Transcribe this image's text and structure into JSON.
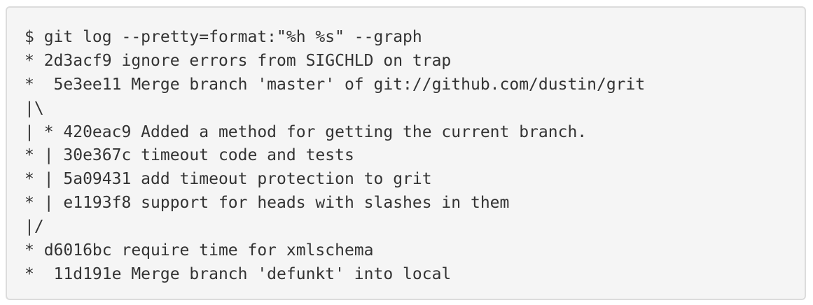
{
  "code_block": {
    "lines": [
      "$ git log --pretty=format:\"%h %s\" --graph",
      "* 2d3acf9 ignore errors from SIGCHLD on trap",
      "*  5e3ee11 Merge branch 'master' of git://github.com/dustin/grit",
      "|\\",
      "| * 420eac9 Added a method for getting the current branch.",
      "* | 30e367c timeout code and tests",
      "* | 5a09431 add timeout protection to grit",
      "* | e1193f8 support for heads with slashes in them",
      "|/",
      "* d6016bc require time for xmlschema",
      "*  11d191e Merge branch 'defunkt' into local"
    ]
  }
}
